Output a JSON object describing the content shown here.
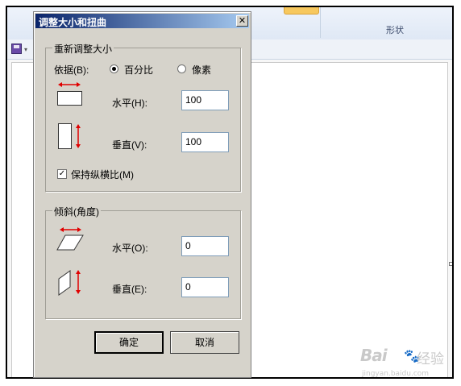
{
  "background_app": {
    "ribbon_group_label": "形状"
  },
  "dialog": {
    "title": "调整大小和扭曲",
    "close_glyph": "✕",
    "resize_group": {
      "legend": "重新调整大小",
      "basis_label": "依据(B):",
      "options": [
        "百分比",
        "像素"
      ],
      "selected_option": "百分比",
      "horizontal_label": "水平(H):",
      "horizontal_value": "100",
      "vertical_label": "垂直(V):",
      "vertical_value": "100",
      "keep_ratio_label": "保持纵横比(M)",
      "keep_ratio_checked": true
    },
    "skew_group": {
      "legend": "倾斜(角度)",
      "horizontal_label": "水平(O):",
      "horizontal_value": "0",
      "vertical_label": "垂直(E):",
      "vertical_value": "0"
    },
    "ok_label": "确定",
    "cancel_label": "取消"
  },
  "watermark": {
    "brand": "Bai",
    "paw": "🐾",
    "cn": "经验",
    "url": "jingyan.baidu.com"
  },
  "colors": {
    "titlebar_start": "#0a246a",
    "titlebar_end": "#a6caf0",
    "dialog_face": "#d6d3cb",
    "arrow_red": "#e00000"
  }
}
